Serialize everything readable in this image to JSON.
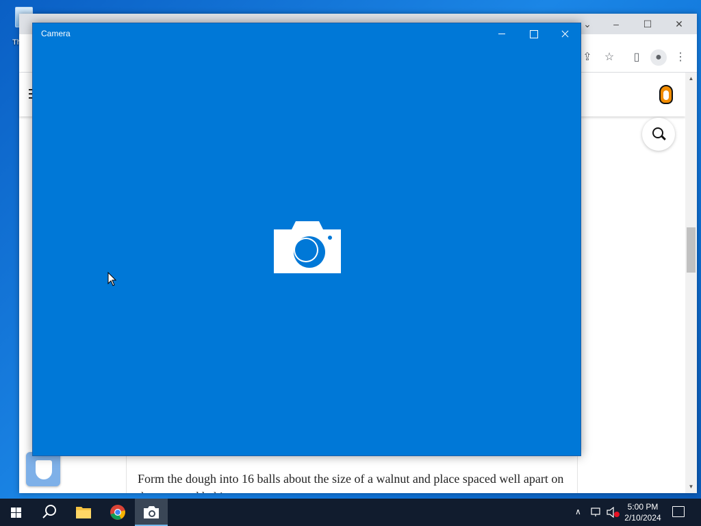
{
  "desktop": {
    "icon_label": "Th"
  },
  "browser": {
    "article_text": "Form the dough into 16 balls about the size of a walnut and place spaced well apart on the prepared baking tray"
  },
  "camera_app": {
    "title": "Camera",
    "background_color": "#0078d7",
    "center_icon": "camera-icon"
  },
  "taskbar": {
    "pinned": [
      {
        "name": "start",
        "icon": "windows-logo-icon"
      },
      {
        "name": "search",
        "icon": "search-icon"
      },
      {
        "name": "file-explorer",
        "icon": "folder-icon"
      },
      {
        "name": "chrome",
        "icon": "chrome-icon"
      },
      {
        "name": "camera",
        "icon": "camera-icon",
        "active": true
      }
    ],
    "clock": {
      "time": "5:00 PM",
      "date": "2/10/2024"
    }
  }
}
